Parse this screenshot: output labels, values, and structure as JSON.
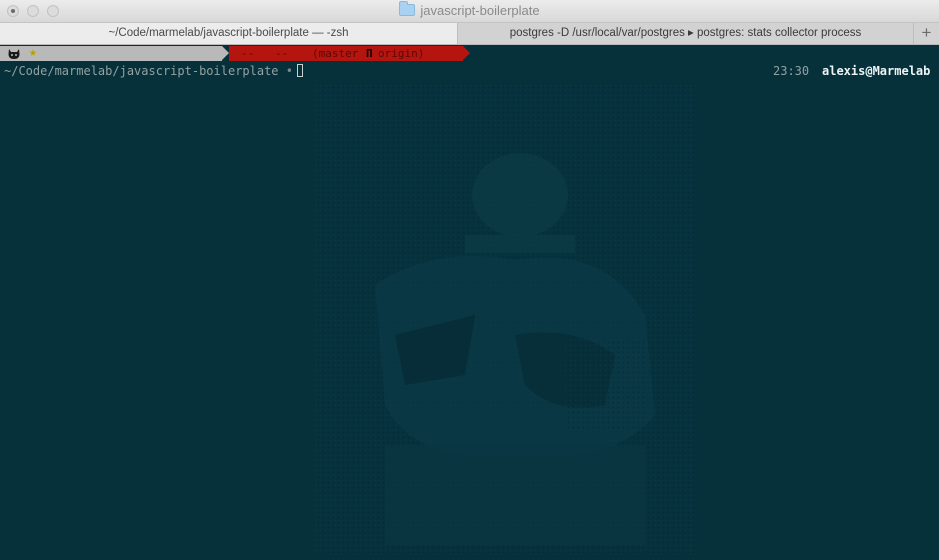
{
  "window": {
    "title": "javascript-boilerplate"
  },
  "tabs": [
    {
      "label": "~/Code/marmelab/javascript-boilerplate — -zsh",
      "active": true
    },
    {
      "label": "postgres -D /usr/local/var/postgres ▸ postgres: stats collector process",
      "active": false
    }
  ],
  "tab_add_label": "+",
  "prompt": {
    "git_branch_text": "(master",
    "git_icon_glyph": "Π",
    "git_remote_text": "origin)",
    "dash_1": "--",
    "dash_2": "--",
    "path": "~/Code/marmelab/javascript-boilerplate",
    "separator": "•",
    "time": "23:30",
    "user": "alexis@Marmelab"
  },
  "icons": {
    "folder": "folder-icon",
    "cat": "github-octocat-icon",
    "star": "star-icon"
  },
  "colors": {
    "terminal_bg": "#06303a",
    "segment_gray": "#b9b9b9",
    "segment_red": "#b5150f",
    "text": "#93a1a1",
    "user": "#eef4f4"
  }
}
